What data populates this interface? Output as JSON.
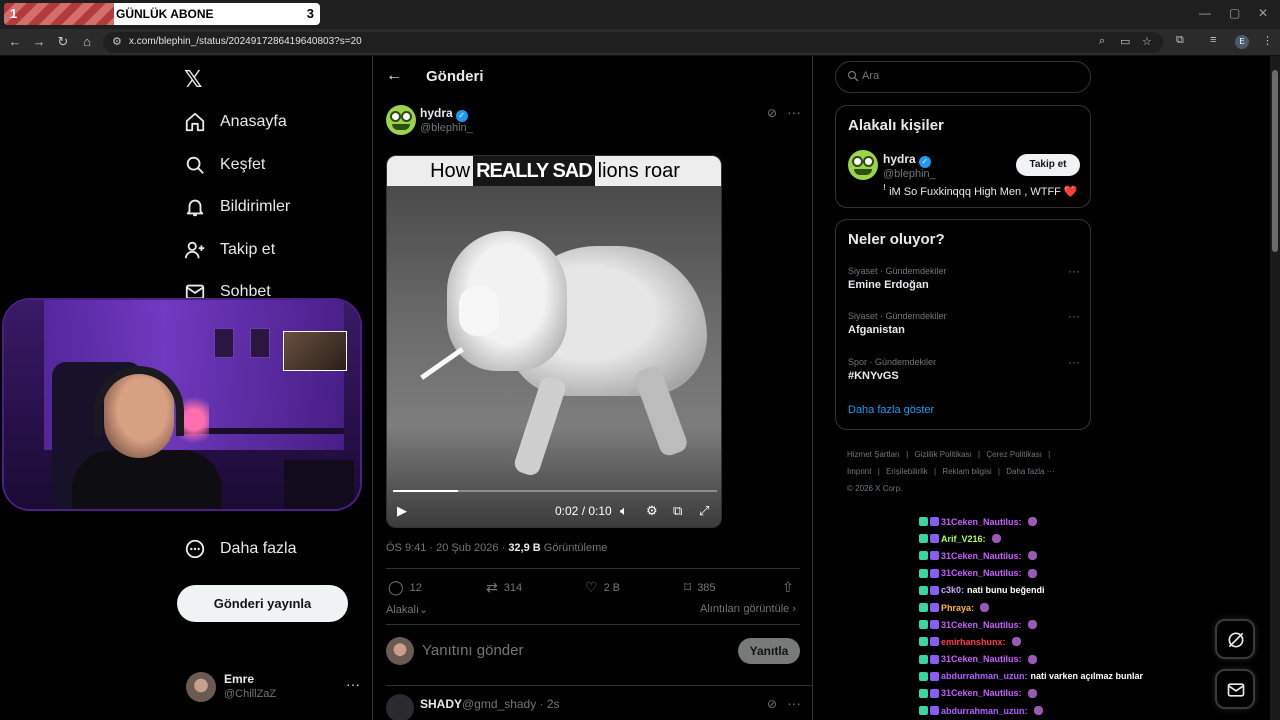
{
  "browser": {
    "tab_number_left": "1",
    "tab_title": "GÜNLÜK ABONE",
    "tab_number_right": "3",
    "url": "x.com/blephin_/status/2024917286419640803?s=20",
    "profile_initial": "E"
  },
  "nav": {
    "items": [
      {
        "label": "Anasayfa",
        "icon": "home-icon"
      },
      {
        "label": "Keşfet",
        "icon": "search-icon"
      },
      {
        "label": "Bildirimler",
        "icon": "bell-icon"
      },
      {
        "label": "Takip et",
        "icon": "follow-icon"
      },
      {
        "label": "Sohbet",
        "icon": "chat-icon"
      }
    ],
    "more_label": "Daha fazla",
    "post_button": "Gönderi yayınla",
    "account": {
      "name": "Emre",
      "handle": "@ChillZaZ"
    }
  },
  "post": {
    "header_title": "Gönderi",
    "author_name": "hydra",
    "author_handle": "@blephin_",
    "video": {
      "caption_before": "How",
      "caption_highlight": "REALLY SAD",
      "caption_after": "lions roar",
      "time": "0:02 / 0:10",
      "progress": 0.2
    },
    "meta_time": "ÖS 9:41 · 20 Şub 2026 · ",
    "views_count": "32,9 B",
    "views_label": " Görüntüleme",
    "stats": {
      "replies": "12",
      "reposts": "314",
      "likes": "2 B",
      "bookmarks": "385"
    },
    "relevant_link": "Alakalı",
    "quotes_link": "Alıntıları görüntüle",
    "reply_placeholder": "Yanıtını gönder",
    "reply_button": "Yanıtla",
    "next_reply": {
      "name": "SHADY",
      "handle": "@gmd_shady · 2s"
    }
  },
  "sidebar": {
    "search_placeholder": "Ara",
    "relevant_title": "Alakalı kişiler",
    "relevant_person": {
      "name": "hydra",
      "handle": "@blephin_",
      "bio": "ꜝ iM So Fuxkinqqq High Men , WTFF ❤️",
      "follow_label": "Takip et"
    },
    "trends_title": "Neler oluyor?",
    "trends": [
      {
        "category": "Siyaset · Gündemdekiler",
        "name": "Emine Erdoğan"
      },
      {
        "category": "Siyaset · Gündemdekiler",
        "name": "Afganistan"
      },
      {
        "category": "Spor · Gündemdekiler",
        "name": "#KNYvGS"
      }
    ],
    "show_more": "Daha fazla göster",
    "footer": [
      "Hizmet Şartları",
      "|",
      "Gizlilik Politikası",
      "|",
      "Çerez Politikası",
      "|",
      "Imprint",
      "|",
      "Erişilebilirlik",
      "|",
      "Reklam bilgisi",
      "|",
      "Daha fazla ···",
      "© 2026 X Corp."
    ]
  },
  "chat": [
    {
      "user": "31Ceken_Nautilus:",
      "color": "#c75fff",
      "msg": ""
    },
    {
      "user": "Arif_V216:",
      "color": "#a8ff5a",
      "msg": ""
    },
    {
      "user": "31Ceken_Nautilus:",
      "color": "#c75fff",
      "msg": ""
    },
    {
      "user": "31Ceken_Nautilus:",
      "color": "#c75fff",
      "msg": ""
    },
    {
      "user": "c3k0:",
      "color": "#c9a7ff",
      "msg": "nati bunu beğendi"
    },
    {
      "user": "Phraya:",
      "color": "#ffb63b",
      "msg": ""
    },
    {
      "user": "31Ceken_Nautilus:",
      "color": "#c75fff",
      "msg": ""
    },
    {
      "user": "emirhanshunx:",
      "color": "#ff3b4e",
      "msg": ""
    },
    {
      "user": "31Ceken_Nautilus:",
      "color": "#c75fff",
      "msg": ""
    },
    {
      "user": "abdurrahman_uzun:",
      "color": "#b35cff",
      "msg": "nati varken açılmaz bunlar"
    },
    {
      "user": "31Ceken_Nautilus:",
      "color": "#c75fff",
      "msg": ""
    },
    {
      "user": "abdurrahman_uzun:",
      "color": "#b35cff",
      "msg": ""
    }
  ]
}
